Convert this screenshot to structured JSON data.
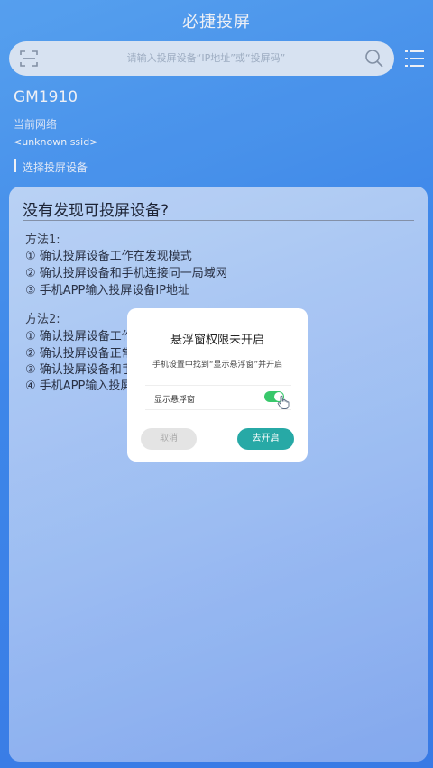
{
  "header": {
    "title": "必捷投屏"
  },
  "search": {
    "placeholder": "请输入投屏设备“IP地址”或“投屏码”"
  },
  "device": {
    "name": "GM1910",
    "network_label": "当前网络",
    "ssid": "<unknown ssid>",
    "section_label": "选择投屏设备"
  },
  "card": {
    "title": "没有发现可投屏设备?",
    "method1": {
      "title": "方法1:",
      "steps": [
        "① 确认投屏设备工作在发现模式",
        "② 确认投屏设备和手机连接同一局域网",
        "③ 手机APP输入投屏设备IP地址"
      ]
    },
    "method2": {
      "title": "方法2:",
      "steps": [
        "① 确认投屏设备工作",
        "② 确认投屏设备正常",
        "③ 确认投屏设备和手",
        "④ 手机APP输入投屏"
      ]
    }
  },
  "dialog": {
    "title": "悬浮窗权限未开启",
    "message": "手机设置中找到“显示悬浮窗”并开启",
    "setting_label": "显示悬浮窗",
    "toggle_on": true,
    "cancel_label": "取消",
    "confirm_label": "去开启"
  },
  "colors": {
    "background": "#3f8cf2",
    "confirm_button": "#27a9a6",
    "toggle_on": "#38c86b"
  },
  "icons": {
    "scan": "scan-frame-icon",
    "search": "search-icon",
    "menu": "menu-list-icon",
    "hand": "hand-pointer-icon"
  }
}
